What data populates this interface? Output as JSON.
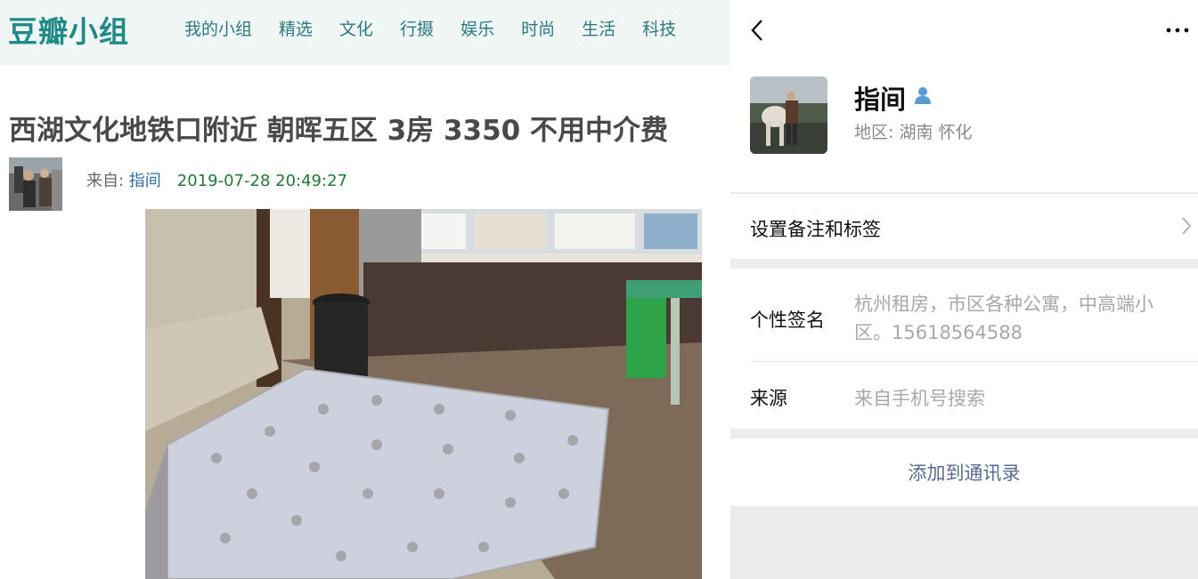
{
  "douban": {
    "logo": "豆瓣小组",
    "nav": [
      "我的小组",
      "精选",
      "文化",
      "行摄",
      "娱乐",
      "时尚",
      "生活",
      "科技"
    ],
    "post": {
      "title": "西湖文化地铁口附近 朝晖五区 3房 3350 不用中介费",
      "from_label": "来自: ",
      "author": "指间",
      "datetime": "2019-07-28 20:49:27"
    }
  },
  "wechat": {
    "name": "指间",
    "region": "地区:  湖南  怀化",
    "remark_label": "设置备注和标签",
    "signature_label": "个性签名",
    "signature_value": "杭州租房，市区各种公寓，中高端小区。15618564588",
    "source_label": "来源",
    "source_value": "来自手机号搜索",
    "add_button": "添加到通讯录",
    "icons": [
      "back-icon",
      "more-icon",
      "person-icon",
      "chevron-right-icon"
    ]
  },
  "colors": {
    "logo": "#1f8a87",
    "nav": "#2e7a82",
    "datetime": "#1f7a36",
    "link_blue": "#576b95",
    "wechat_gray": "#ededed"
  }
}
